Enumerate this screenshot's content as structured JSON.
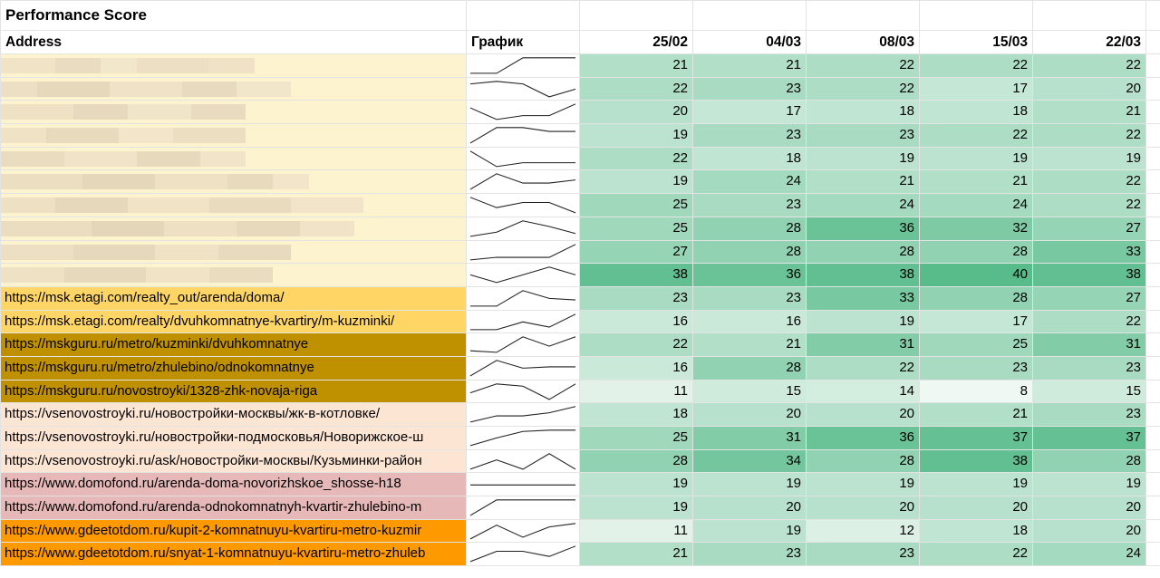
{
  "title": "Performance Score",
  "headers": {
    "address": "Address",
    "chart": "График",
    "dates": [
      "25/02",
      "04/03",
      "08/03",
      "15/03",
      "22/03"
    ]
  },
  "colors": {
    "cream": "#fef3cf",
    "yellow": "#ffd666",
    "gold": "#bf9000",
    "peach": "#fde5d4",
    "rose": "#e6b8b7",
    "orange": "#ff9900",
    "grid": "#e2e3e3"
  },
  "rows": [
    {
      "address": "",
      "bg": "cream",
      "values": [
        21,
        21,
        22,
        22,
        22
      ]
    },
    {
      "address": "",
      "bg": "cream",
      "values": [
        22,
        23,
        22,
        17,
        20
      ]
    },
    {
      "address": "",
      "bg": "cream",
      "values": [
        20,
        17,
        18,
        18,
        21
      ]
    },
    {
      "address": "",
      "bg": "cream",
      "values": [
        19,
        23,
        23,
        22,
        22
      ]
    },
    {
      "address": "",
      "bg": "cream",
      "values": [
        22,
        18,
        19,
        19,
        19
      ]
    },
    {
      "address": "",
      "bg": "cream",
      "values": [
        19,
        24,
        21,
        21,
        22
      ]
    },
    {
      "address": "",
      "bg": "cream",
      "values": [
        25,
        23,
        24,
        24,
        22
      ]
    },
    {
      "address": "",
      "bg": "cream",
      "values": [
        25,
        28,
        36,
        32,
        27
      ]
    },
    {
      "address": "",
      "bg": "cream",
      "values": [
        27,
        28,
        28,
        28,
        33
      ]
    },
    {
      "address": "",
      "bg": "cream",
      "values": [
        38,
        36,
        38,
        40,
        38
      ]
    },
    {
      "address": "https://msk.etagi.com/realty_out/arenda/doma/",
      "bg": "yellow",
      "values": [
        23,
        23,
        33,
        28,
        27
      ]
    },
    {
      "address": "https://msk.etagi.com/realty/dvuhkomnatnye-kvartiry/m-kuzminki/",
      "bg": "yellow",
      "values": [
        16,
        16,
        19,
        17,
        22
      ]
    },
    {
      "address": "https://mskguru.ru/metro/kuzminki/dvuhkomnatnye",
      "bg": "gold",
      "values": [
        22,
        21,
        31,
        25,
        31
      ]
    },
    {
      "address": "https://mskguru.ru/metro/zhulebino/odnokomnatnye",
      "bg": "gold",
      "values": [
        16,
        28,
        22,
        23,
        23
      ]
    },
    {
      "address": "https://mskguru.ru/novostroyki/1328-zhk-novaja-riga",
      "bg": "gold",
      "values": [
        11,
        15,
        14,
        8,
        15
      ]
    },
    {
      "address": "https://vsenovostroyki.ru/новостройки-москвы/жк-в-котловке/",
      "bg": "peach",
      "values": [
        18,
        20,
        20,
        21,
        23
      ]
    },
    {
      "address": "https://vsenovostroyki.ru/новостройки-подмосковья/Новорижское-ш",
      "bg": "peach",
      "values": [
        25,
        31,
        36,
        37,
        37
      ]
    },
    {
      "address": "https://vsenovostroyki.ru/ask/новостройки-москвы/Кузьминки-район",
      "bg": "peach",
      "values": [
        28,
        34,
        28,
        38,
        28
      ]
    },
    {
      "address": "https://www.domofond.ru/arenda-doma-novorizhskoe_shosse-h18",
      "bg": "rose",
      "values": [
        19,
        19,
        19,
        19,
        19
      ]
    },
    {
      "address": "https://www.domofond.ru/arenda-odnokomnatnyh-kvartir-zhulebino-m",
      "bg": "rose",
      "values": [
        19,
        20,
        20,
        20,
        20
      ]
    },
    {
      "address": "https://www.gdeetotdom.ru/kupit-2-komnatnuyu-kvartiru-metro-kuzmir",
      "bg": "orange",
      "values": [
        11,
        19,
        12,
        18,
        20
      ]
    },
    {
      "address": "https://www.gdeetotdom.ru/snyat-1-komnatnuyu-kvartiru-metro-zhuleb",
      "bg": "orange",
      "values": [
        21,
        23,
        23,
        22,
        24
      ]
    }
  ]
}
